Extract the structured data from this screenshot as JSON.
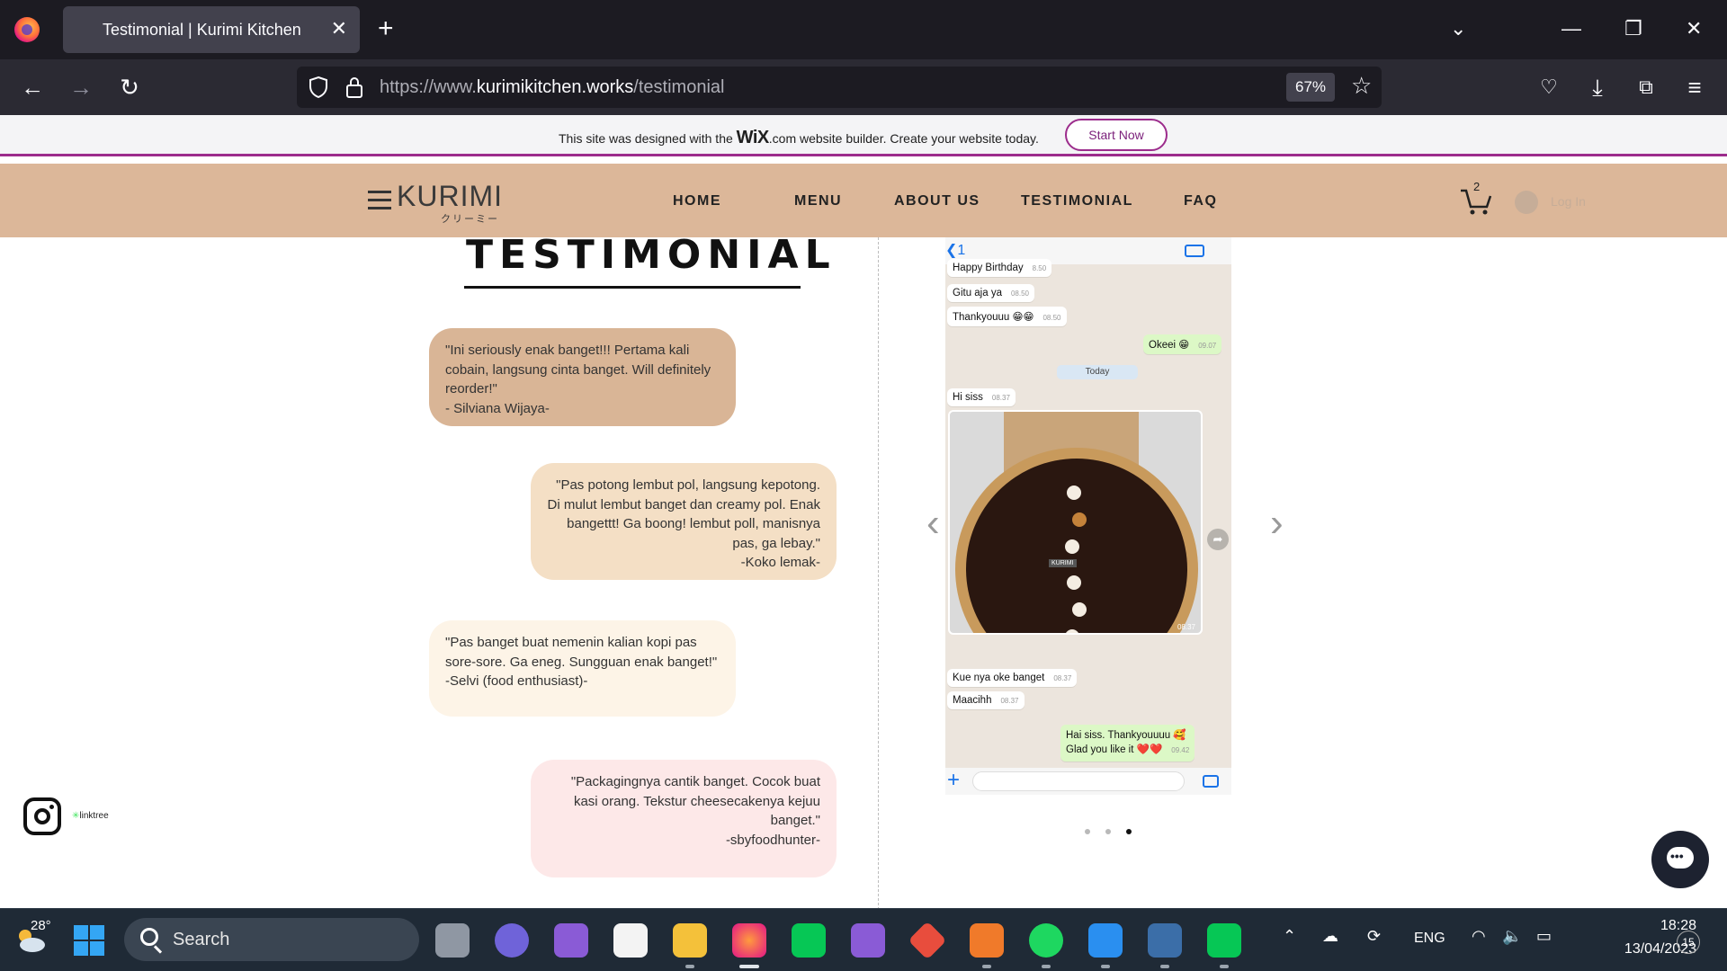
{
  "browser": {
    "tab_title": "Testimonial | Kurimi Kitchen",
    "url_prefix": "https://www.",
    "url_domain": "kurimikitchen.works",
    "url_path": "/testimonial",
    "zoom": "67%"
  },
  "wix_banner": {
    "text_before": "This site was designed with the ",
    "brand": "WiX",
    "text_after": ".com website builder. Create your website today.",
    "cta": "Start Now"
  },
  "site": {
    "logo": "KURIMI",
    "logo_sub": "クリーミー",
    "nav": [
      "HOME",
      "MENU",
      "ABOUT US",
      "TESTIMONIAL",
      "FAQ"
    ],
    "cart_count": "2",
    "login": "Log In"
  },
  "page": {
    "title": "TESTIMONIAL",
    "testimonials": [
      {
        "quote": "\"Ini seriously enak banget!!! Pertama kali cobain, langsung cinta banget. Will definitely reorder!\"",
        "author": "- Silviana Wijaya-"
      },
      {
        "quote": "\"Pas potong lembut pol, langsung kepotong. Di mulut lembut banget dan creamy pol. Enak bangettt! Ga boong! lembut poll, manisnya pas, ga lebay.\"",
        "author": "-Koko lemak-"
      },
      {
        "quote": "\"Pas banget buat nemenin kalian kopi pas sore-sore. Ga eneg. Sungguan enak banget!\"",
        "author": "-Selvi (food enthusiast)-"
      },
      {
        "quote": "\"Packagingnya cantik banget.  Cocok buat kasi orang. Tekstur cheesecakenya kejuu banget.\"",
        "author": "-sbyfoodhunter-"
      }
    ],
    "linktree": "linktree"
  },
  "chat": {
    "back": "1",
    "messages": [
      {
        "text": "Happy Birthday",
        "time": "8.50"
      },
      {
        "text": "Gitu aja ya",
        "time": "08.50"
      },
      {
        "text": "Thankyouuu 😁😁",
        "time": "08.50"
      },
      {
        "text": "Okeei 😁",
        "time": "09.07"
      },
      {
        "text": "Hi siss",
        "time": "08.37"
      },
      {
        "text": "Kue nya oke banget",
        "time": "08.37"
      },
      {
        "text": "Maacihh",
        "time": "08.37"
      },
      {
        "text": "Hai siss. Thankyouuuu 🥰",
        "time": ""
      },
      {
        "text": "Glad you like it ❤️❤️",
        "time": "09.42"
      }
    ],
    "day_label": "Today",
    "photo_time": "08.37",
    "photo_label": "KURIMI"
  },
  "taskbar": {
    "temperature": "28°",
    "search": "Search",
    "language": "ENG",
    "time": "18:28",
    "date": "13/04/2023",
    "notifications": "15"
  }
}
